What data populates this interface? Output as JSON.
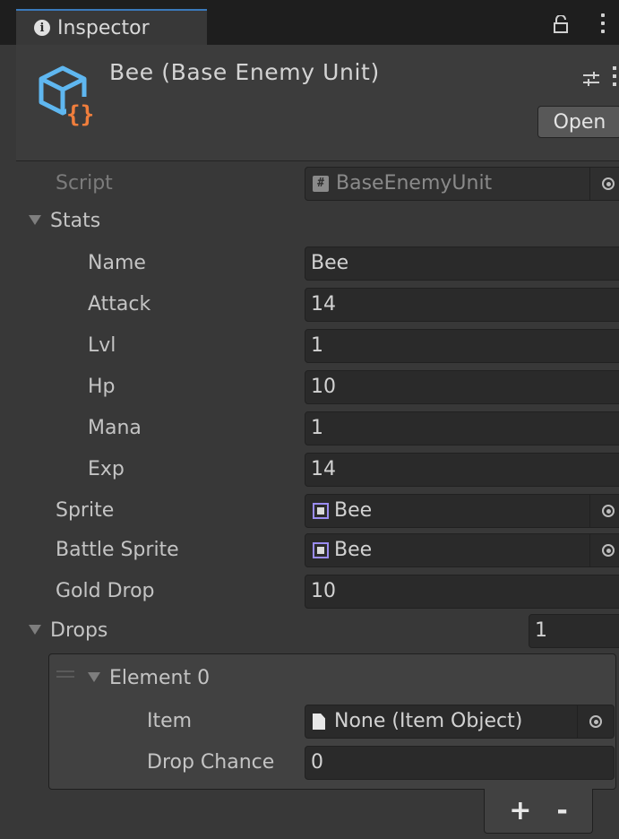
{
  "tab": {
    "label": "Inspector"
  },
  "header": {
    "title": "Bee (Base Enemy Unit)",
    "open_label": "Open"
  },
  "script": {
    "label": "Script",
    "value": "BaseEnemyUnit"
  },
  "stats": {
    "label": "Stats",
    "fields": [
      {
        "label": "Name",
        "value": "Bee"
      },
      {
        "label": "Attack",
        "value": "14"
      },
      {
        "label": "Lvl",
        "value": "1"
      },
      {
        "label": "Hp",
        "value": "10"
      },
      {
        "label": "Mana",
        "value": "1"
      },
      {
        "label": "Exp",
        "value": "14"
      }
    ]
  },
  "sprite": {
    "label": "Sprite",
    "value": "Bee"
  },
  "battle_sprite": {
    "label": "Battle Sprite",
    "value": "Bee"
  },
  "gold_drop": {
    "label": "Gold Drop",
    "value": "10"
  },
  "drops": {
    "label": "Drops",
    "size": "1",
    "element": {
      "label": "Element 0",
      "item_label": "Item",
      "item_value": "None (Item Object)",
      "chance_label": "Drop Chance",
      "chance_value": "0"
    },
    "add_label": "+",
    "remove_label": "-"
  },
  "colors": {
    "background": "#383838",
    "field": "#2a2a2a",
    "accent_tab": "#3a79bb",
    "script_icon_blue": "#5fb7f0",
    "script_icon_orange": "#f07e3c",
    "sprite_icon": "#9a8cf0"
  }
}
